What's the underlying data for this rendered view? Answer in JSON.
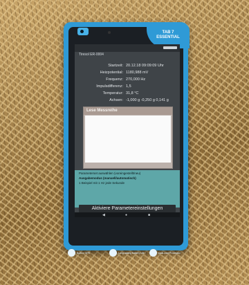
{
  "tablet": {
    "brand_line1": "TAB 7",
    "brand_line2": "ESSENTIAL"
  },
  "screen": {
    "device_id": "Tiresol ER-0004",
    "fields": [
      {
        "label": "Startzeit:",
        "value": "20.12.18 09:09:09 Uhr"
      },
      {
        "label": "Heizpotential:",
        "value": "1180,988 mV"
      },
      {
        "label": "Frequenz:",
        "value": "270,000 Hz"
      },
      {
        "label": "Impulsdifferenz:",
        "value": "1,5"
      },
      {
        "label": "Temperatur:",
        "value": "31,8 °C"
      },
      {
        "label": "Achsen:",
        "value": "-1,000 g -0,250 g 0,141 g"
      }
    ],
    "dialog_title": "Lese Messreihe",
    "lower_line1": "Parameterset auswählen (voreingestellt/neu)",
    "lower_line2": "Ausgabemodus (manuell/automatisch)",
    "lower_line3": "1 Beispiel mit 1 Hz jede Sekunde",
    "apply_button": "Aktiviere Parametereinstellungen",
    "nav_back": "◀",
    "nav_home": "●",
    "nav_recent": "■"
  },
  "bezel": {
    "left_label": "Built-in GPS",
    "middle_label": "Long-lasting Battery Life",
    "right_label": "Dual-core Processor"
  }
}
